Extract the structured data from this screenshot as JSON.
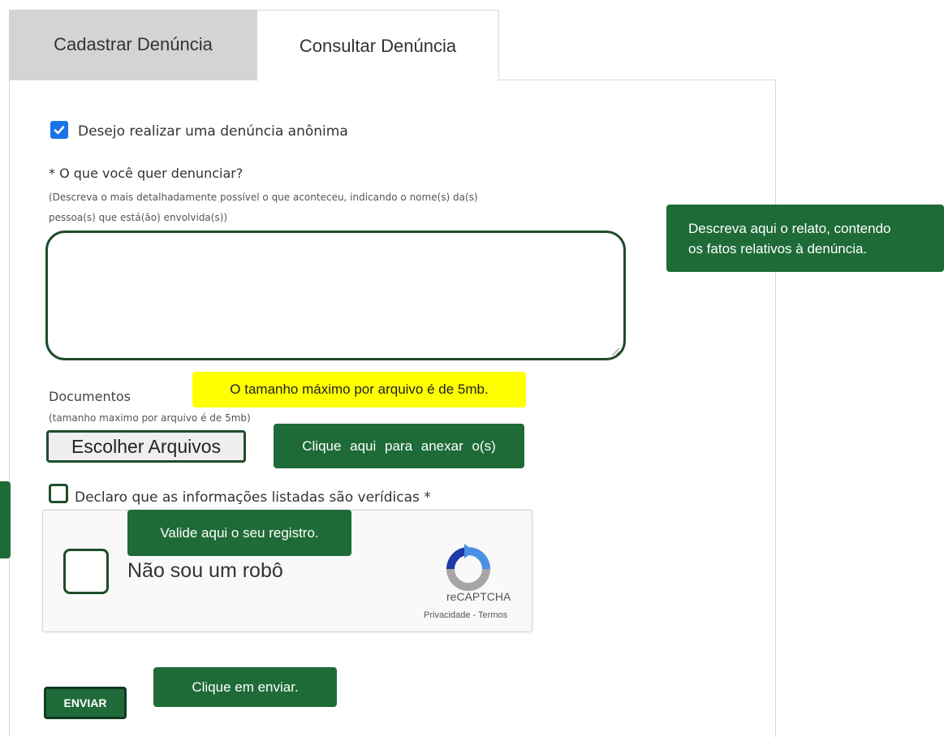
{
  "tabs": {
    "cadastrar": "Cadastrar Denúncia",
    "consultar": "Consultar Denúncia"
  },
  "form": {
    "anonymous_label": "Desejo realizar uma denúncia anônima",
    "anonymous_checked": true,
    "question_label": "* O que você quer denunciar?",
    "question_help_1": "(Descreva o mais detalhadamente possível o que aconteceu, indicando o nome(s) da(s)",
    "question_help_2": "pessoa(s) que está(ão) envolvida(s))",
    "description_value": "",
    "documents_label": "Documentos",
    "documents_help": "(tamanho maximo por arquivo é de 5mb)",
    "file_button": "Escolher Arquivos",
    "declaration_label": "Declaro que as informações listadas são verídicas *",
    "declaration_checked": false,
    "submit_label": "ENVIAR"
  },
  "captcha": {
    "label": "Não sou um robô",
    "brand": "reCAPTCHA",
    "links": "Privacidade - Termos",
    "checked": false
  },
  "callouts": {
    "relato_line1": "Descreva aqui o relato, contendo",
    "relato_line2": "os fatos relativos à denúncia.",
    "file_size": "O tamanho máximo por arquivo é de 5mb.",
    "anexar": "Clique aqui para anexar o(s)",
    "valide": "Valide aqui o seu registro.",
    "enviar": "Clique em enviar."
  },
  "colors": {
    "callout_green": "#1e6b37",
    "callout_border": "#1e4d2b",
    "callout_yellow": "#ffff00",
    "checkbox_blue": "#1a73e8",
    "tab_inactive": "#d4d4d4"
  },
  "icons": {
    "checkmark": "check-icon",
    "recaptcha": "recaptcha-logo-icon"
  }
}
